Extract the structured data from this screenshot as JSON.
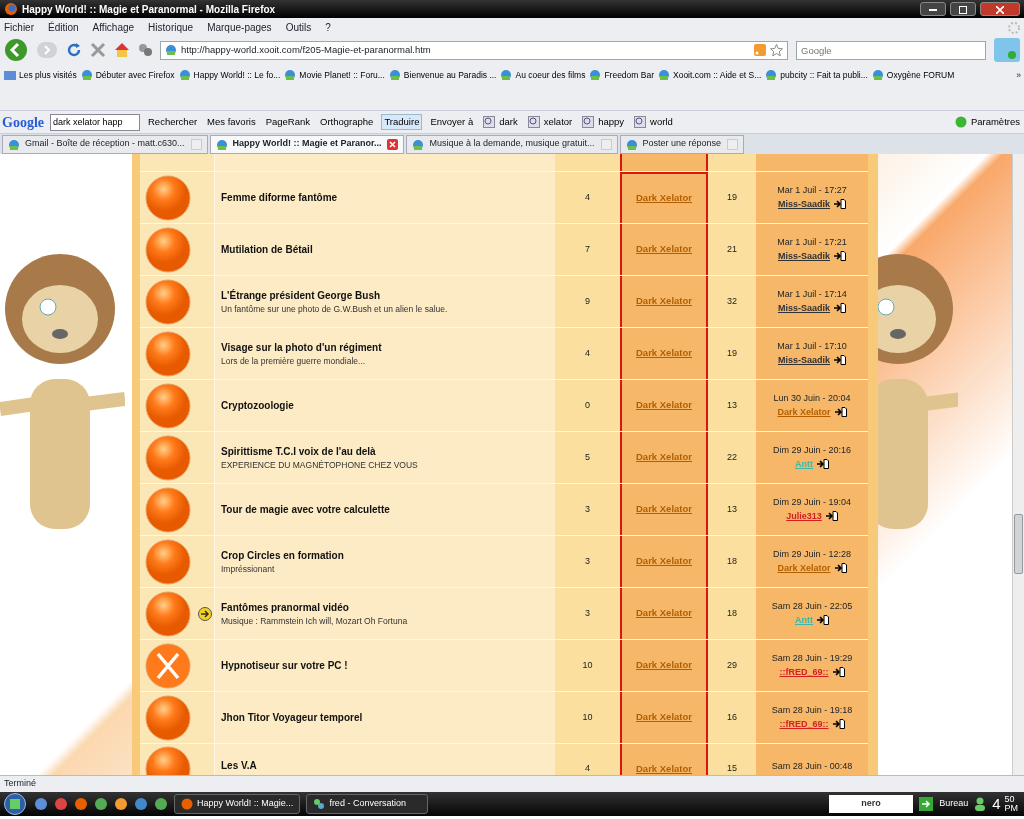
{
  "window": {
    "title": "Happy World! :: Magie et Paranormal - Mozilla Firefox"
  },
  "menu": [
    "Fichier",
    "Édition",
    "Affichage",
    "Historique",
    "Marque-pages",
    "Outils",
    "?"
  ],
  "address_bar": {
    "value": "http://happy-world.xooit.com/f205-Magie-et-paranormal.htm"
  },
  "search_bar": {
    "placeholder": "Google"
  },
  "bookmarks": [
    "Les plus visités",
    "Débuter avec Firefox",
    "Happy World! :: Le fo...",
    "Movie Planet! :: Foru...",
    "Bienvenue au Paradis ...",
    "Au coeur des films",
    "Freedom Bar",
    "Xooit.com :: Aide et S...",
    "pubcity :: Fait ta publi...",
    "Oxygène FORUM"
  ],
  "bookmarks_overflow": "»",
  "google_toolbar": {
    "logo": "Google",
    "query": "dark xelator happ",
    "buttons": [
      "Rechercher",
      "Mes favoris",
      "PageRank",
      "Orthographe",
      "Traduire",
      "Envoyer à"
    ],
    "terms": [
      "dark",
      "xelator",
      "happy",
      "world"
    ],
    "settings": "Paramètres"
  },
  "tabs": [
    {
      "label": "Gmail - Boîte de réception - matt.c630...",
      "selected": false
    },
    {
      "label": "Happy World! :: Magie et Paranor...",
      "selected": true
    },
    {
      "label": "Musique à la demande, musique gratuit...",
      "selected": false
    },
    {
      "label": "Poster une réponse",
      "selected": false
    }
  ],
  "topics": [
    {
      "kind": "normal",
      "arrow": false,
      "title": "Femme diforme fantôme",
      "replies": "4",
      "author": "Dark Xelator",
      "views": "19",
      "last_date": "Mar 1 Juil - 17:27",
      "last_user": "Miss-Saadik",
      "color": "#333333"
    },
    {
      "kind": "normal",
      "arrow": false,
      "title": "Mutilation de Bétail",
      "replies": "7",
      "author": "Dark Xelator",
      "views": "21",
      "last_date": "Mar 1 Juil - 17:21",
      "last_user": "Miss-Saadik",
      "color": "#333333"
    },
    {
      "kind": "normal",
      "arrow": false,
      "title": "L'Étrange président George Bush",
      "description": "Un fantôme sur une photo de G.W.Bush et un alien le salue.",
      "replies": "9",
      "author": "Dark Xelator",
      "views": "32",
      "last_date": "Mar 1 Juil - 17:14",
      "last_user": "Miss-Saadik",
      "color": "#333333"
    },
    {
      "kind": "normal",
      "arrow": false,
      "title": "Visage sur la photo d'un régiment",
      "description": "Lors de la première guerre mondiale...",
      "replies": "4",
      "author": "Dark Xelator",
      "views": "19",
      "last_date": "Mar 1 Juil - 17:10",
      "last_user": "Miss-Saadik",
      "color": "#333333"
    },
    {
      "kind": "normal",
      "arrow": false,
      "title": "Cryptozoologie",
      "replies": "0",
      "author": "Dark Xelator",
      "views": "13",
      "last_date": "Lun 30 Juin - 20:04",
      "last_user": "Dark Xelator",
      "color": "#b35f00"
    },
    {
      "kind": "normal",
      "arrow": false,
      "title": "Spirittisme T.C.I voix de l'au delà",
      "description": "EXPERIENCE DU MAGNÉTOPHONE CHEZ VOUS",
      "replies": "5",
      "author": "Dark Xelator",
      "views": "22",
      "last_date": "Dim 29 Juin - 20:16",
      "last_user": "Antt",
      "color": "#3cb8a8"
    },
    {
      "kind": "normal",
      "arrow": false,
      "title": "Tour de magie avec votre calculette",
      "replies": "3",
      "author": "Dark Xelator",
      "views": "13",
      "last_date": "Dim 29 Juin - 19:04",
      "last_user": "Julie313",
      "color": "#d42020"
    },
    {
      "kind": "normal",
      "arrow": false,
      "title": "Crop Circles en formation",
      "description": "Impréssionant",
      "replies": "3",
      "author": "Dark Xelator",
      "views": "18",
      "last_date": "Dim 29 Juin - 12:28",
      "last_user": "Dark Xelator",
      "color": "#b35f00"
    },
    {
      "kind": "normal",
      "arrow": true,
      "title": "Fantômes pranormal vidéo",
      "description": "Musique : Rammstein Ich will, Mozart Oh Fortuna",
      "replies": "3",
      "author": "Dark Xelator",
      "views": "18",
      "last_date": "Sam 28 Juin - 22:05",
      "last_user": "Antt",
      "color": "#3cb8a8"
    },
    {
      "kind": "locked",
      "arrow": false,
      "title": "Hypnotiseur sur votre PC !",
      "replies": "10",
      "author": "Dark Xelator",
      "views": "29",
      "last_date": "Sam 28 Juin - 19:29",
      "last_user": "::fRED_69::",
      "color": "#d42020"
    },
    {
      "kind": "normal",
      "arrow": false,
      "title": "Jhon Titor Voyageur temporel",
      "replies": "10",
      "author": "Dark Xelator",
      "views": "16",
      "last_date": "Sam 28 Juin - 19:18",
      "last_user": "::fRED_69::",
      "color": "#d42020"
    },
    {
      "kind": "normal",
      "arrow": false,
      "title": "Les V.A",
      "replies": "4",
      "author": "Dark Xelator",
      "views": "15",
      "last_date": "Sam 28 Juin - 00:48"
    }
  ],
  "status_bar": "Terminé",
  "taskbar": {
    "tasks": [
      "Happy World! :: Magie...",
      "fred - Conversation"
    ],
    "search_logo": "nero",
    "desktop": "Bureau",
    "clock_hour": "4",
    "clock_minutes": "50",
    "clock_period": "PM"
  }
}
